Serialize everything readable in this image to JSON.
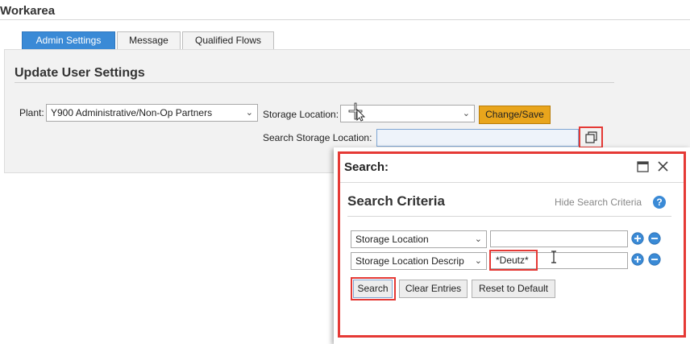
{
  "workarea": {
    "title": "Workarea"
  },
  "tabs": [
    {
      "label": "Admin Settings",
      "active": true
    },
    {
      "label": "Message",
      "active": false
    },
    {
      "label": "Qualified Flows",
      "active": false
    }
  ],
  "settings": {
    "title": "Update User Settings",
    "plant_label": "Plant:",
    "plant_value": "Y900 Administrative/Non-Op Partners",
    "storage_location_label": "Storage Location:",
    "storage_location_value": "",
    "change_save_label": "Change/Save",
    "search_storage_location_label": "Search Storage Location:",
    "search_storage_location_value": "",
    "value_help_icon": "value-help-icon"
  },
  "dialog": {
    "title": "Search:",
    "criteria_title": "Search Criteria",
    "hide_criteria_label": "Hide Search Criteria",
    "rows": [
      {
        "field": "Storage Location",
        "value": ""
      },
      {
        "field": "Storage Location Descrip",
        "value": "*Deutz*"
      }
    ],
    "buttons": {
      "search": "Search",
      "clear": "Clear Entries",
      "reset": "Reset to Default"
    }
  },
  "colors": {
    "accent_tab": "#3a8ad6",
    "change_save_button": "#e9a51c",
    "highlight": "#e53935"
  }
}
